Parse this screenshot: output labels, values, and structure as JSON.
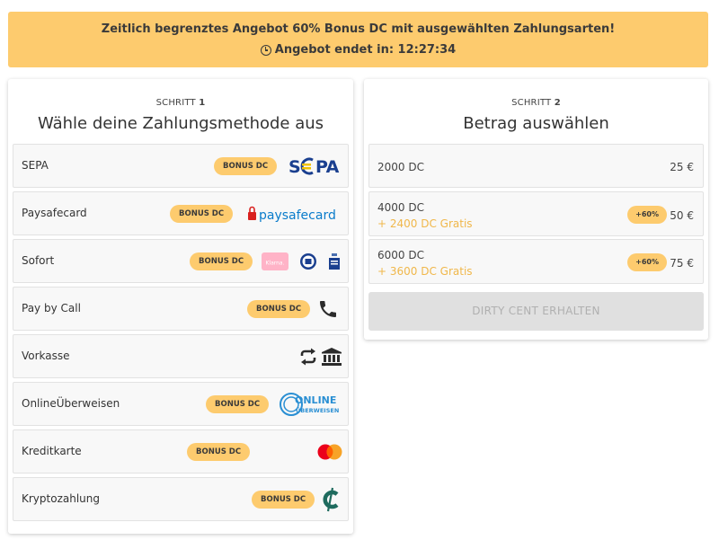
{
  "banner": {
    "headline": "Zeitlich begrenztes Angebot 60% Bonus DC mit ausgewählten Zahlungsarten!",
    "countdown_label": "Angebot endet in: 12:27:34"
  },
  "step1": {
    "step_word": "SCHRITT",
    "step_number": "1",
    "title": "Wähle deine Zahlungsmethode aus",
    "methods": [
      {
        "name": "SEPA",
        "badge": "BONUS DC",
        "logo": "sepa-logo"
      },
      {
        "name": "Paysafecard",
        "badge": "BONUS DC",
        "logo": "paysafecard-logo",
        "logo_text": "paysafecard"
      },
      {
        "name": "Sofort",
        "badge": "BONUS DC",
        "logo": "sofort-logos",
        "logo_text": "Klarna."
      },
      {
        "name": "Pay by Call",
        "badge": "BONUS DC",
        "logo": "phone-icon"
      },
      {
        "name": "Vorkasse",
        "badge": "",
        "logo": "bank-transfer-icon"
      },
      {
        "name": "OnlineÜberweisen",
        "badge": "BONUS DC",
        "logo": "online-ueberweisen-logo",
        "logo_text_1": "ONLINE",
        "logo_text_2": "ÜBERWEISEN"
      },
      {
        "name": "Kreditkarte",
        "badge": "BONUS DC",
        "logo": "mastercard-logo"
      },
      {
        "name": "Kryptozahlung",
        "badge": "BONUS DC",
        "logo": "crypto-icon"
      }
    ]
  },
  "step2": {
    "step_word": "SCHRITT",
    "step_number": "2",
    "title": "Betrag auswählen",
    "amounts": [
      {
        "dc": "2000 DC",
        "gratis": "",
        "badge": "",
        "price": "25 €"
      },
      {
        "dc": "4000 DC",
        "gratis": "+ 2400 DC Gratis",
        "badge": "+60%",
        "price": "50 €"
      },
      {
        "dc": "6000 DC",
        "gratis": "+ 3600 DC Gratis",
        "badge": "+60%",
        "price": "75 €"
      }
    ],
    "cta": "DIRTY CENT ERHALTEN"
  },
  "colors": {
    "accent": "#fdcb6e",
    "gratis_text": "#f0b74a",
    "sepa_blue": "#1a3f8f",
    "sepa_yellow": "#f2c200",
    "paysafe_red": "#d9211f",
    "paysafe_blue": "#0a7ccb",
    "klarna_pink": "#ffb3c7",
    "mastercard_red": "#eb001b",
    "mastercard_orange": "#f79e1b",
    "crypto_green": "#1f6b5e",
    "online_ueberweisen_blue": "#2a8fd3",
    "disabled_button": "#e0e0e0"
  }
}
